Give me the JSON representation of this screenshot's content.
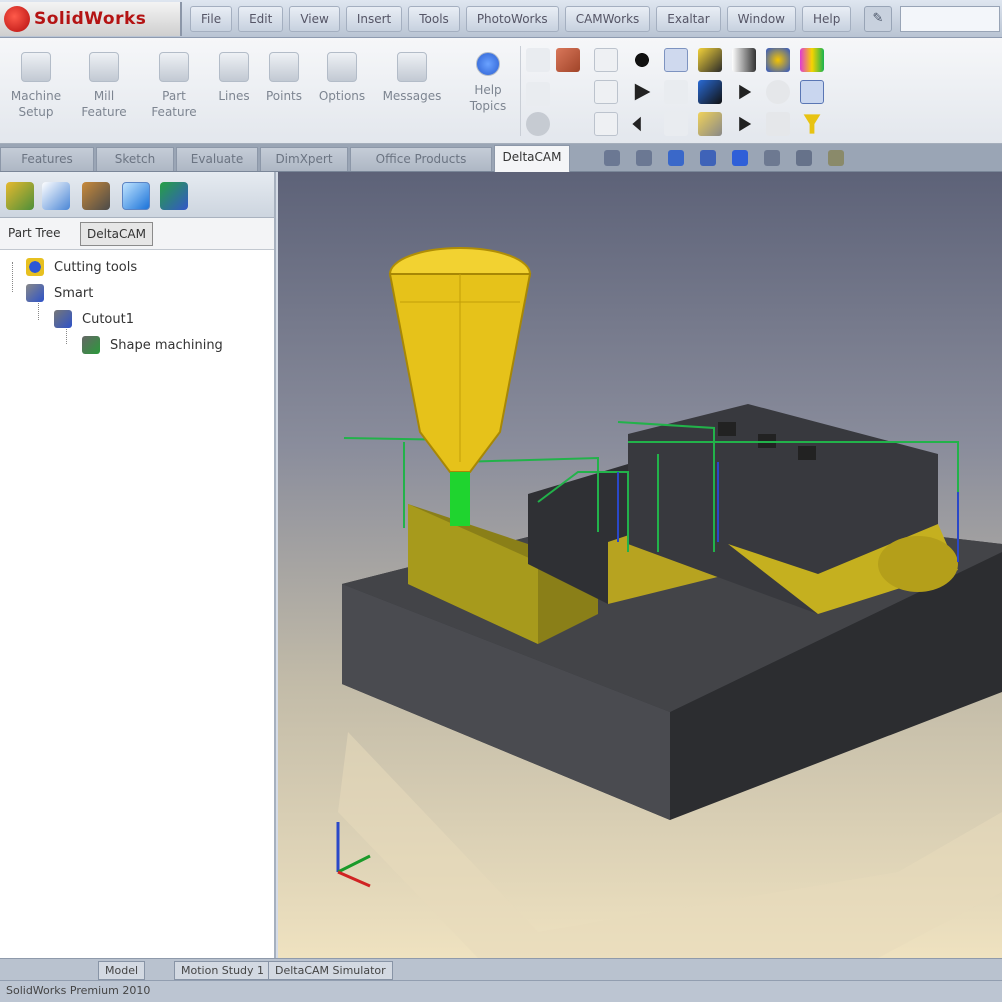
{
  "app": {
    "logo_text": "SolidWorks"
  },
  "menu": [
    "File",
    "Edit",
    "View",
    "Insert",
    "Tools",
    "PhotoWorks",
    "CAMWorks",
    "Exaltar",
    "Window",
    "Help"
  ],
  "ribbon": {
    "buttons": [
      {
        "label": "Machine\nSetup"
      },
      {
        "label": "Mill\nFeature"
      },
      {
        "label": "Part\nFeature"
      },
      {
        "label": "Lines"
      },
      {
        "label": "Points"
      },
      {
        "label": "Options"
      },
      {
        "label": "Messages"
      },
      {
        "label": "Help\nTopics"
      }
    ]
  },
  "tabs": [
    "Features",
    "Sketch",
    "Evaluate",
    "DimXpert",
    "Office Products",
    "DeltaCAM"
  ],
  "left_panel": {
    "subtabs": [
      "Part Tree",
      "DeltaCAM"
    ],
    "tree": [
      {
        "label": "Cutting tools"
      },
      {
        "label": "Smart"
      },
      {
        "label": "Cutout1"
      },
      {
        "label": "Shape machining"
      }
    ]
  },
  "bottom_tabs": [
    "Model",
    "Motion Study 1",
    "DeltaCAM Simulator"
  ],
  "status": "SolidWorks Premium 2010",
  "colors": {
    "tool": "#e6c21a",
    "toolpath": "#22b24a",
    "stock": "#3a3a3d"
  }
}
